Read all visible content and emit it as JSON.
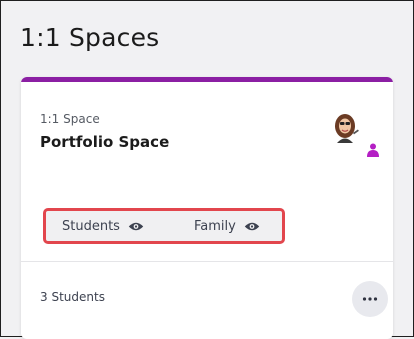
{
  "page": {
    "title": "1:1 Spaces"
  },
  "card": {
    "type_label": "1:1 Space",
    "name": "Portfolio Space",
    "accent_color": "#8b1fa3",
    "visibility": {
      "students_label": "Students",
      "family_label": "Family",
      "icon": "eye-icon"
    },
    "student_count": "3 Students",
    "more_icon": "ellipsis-icon"
  },
  "colors": {
    "highlight_border": "#e2464d",
    "person_badge": "#b41fc4"
  }
}
